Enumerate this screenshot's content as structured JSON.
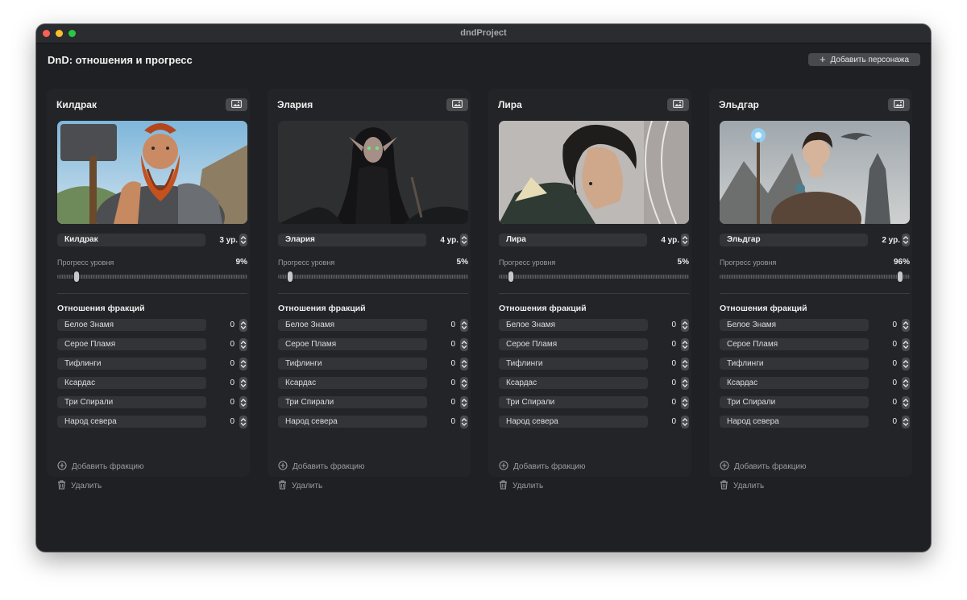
{
  "window": {
    "title": "dndProject"
  },
  "page": {
    "title": "DnD: отношения и прогресс",
    "add_character_label": "Добавить персонажа"
  },
  "labels": {
    "progress": "Прогресс уровня",
    "factions_title": "Отношения фракций",
    "add_faction": "Добавить фракцию",
    "delete": "Удалить"
  },
  "characters": [
    {
      "name": "Килдрак",
      "level_text": "3 ур.",
      "progress_text": "9%",
      "progress": 0.09,
      "portrait_icon": "dwarf-portrait",
      "factions": [
        {
          "name": "Белое Знамя",
          "value": "0"
        },
        {
          "name": "Серое Пламя",
          "value": "0"
        },
        {
          "name": "Тифлинги",
          "value": "0"
        },
        {
          "name": "Ксардас",
          "value": "0"
        },
        {
          "name": "Три Спирали",
          "value": "0"
        },
        {
          "name": "Народ севера",
          "value": "0"
        }
      ]
    },
    {
      "name": "Элария",
      "level_text": "4 ур.",
      "progress_text": "5%",
      "progress": 0.05,
      "portrait_icon": "dark-elf-portrait",
      "factions": [
        {
          "name": "Белое Знамя",
          "value": "0"
        },
        {
          "name": "Серое Пламя",
          "value": "0"
        },
        {
          "name": "Тифлинги",
          "value": "0"
        },
        {
          "name": "Ксардас",
          "value": "0"
        },
        {
          "name": "Три Спирали",
          "value": "0"
        },
        {
          "name": "Народ севера",
          "value": "0"
        }
      ]
    },
    {
      "name": "Лира",
      "level_text": "4 ур.",
      "progress_text": "5%",
      "progress": 0.05,
      "portrait_icon": "sketch-portrait",
      "factions": [
        {
          "name": "Белое Знамя",
          "value": "0"
        },
        {
          "name": "Серое Пламя",
          "value": "0"
        },
        {
          "name": "Тифлинги",
          "value": "0"
        },
        {
          "name": "Ксардас",
          "value": "0"
        },
        {
          "name": "Три Спирали",
          "value": "0"
        },
        {
          "name": "Народ севера",
          "value": "0"
        }
      ]
    },
    {
      "name": "Эльдгар",
      "level_text": "2 ур.",
      "progress_text": "96%",
      "progress": 0.96,
      "portrait_icon": "mage-portrait",
      "factions": [
        {
          "name": "Белое Знамя",
          "value": "0"
        },
        {
          "name": "Серое Пламя",
          "value": "0"
        },
        {
          "name": "Тифлинги",
          "value": "0"
        },
        {
          "name": "Ксардас",
          "value": "0"
        },
        {
          "name": "Три Спирали",
          "value": "0"
        },
        {
          "name": "Народ севера",
          "value": "0"
        }
      ]
    }
  ],
  "colors": {
    "window_bg": "#1f2023",
    "card_bg": "#232427",
    "field_bg": "#333437",
    "button_bg": "#48494c"
  }
}
